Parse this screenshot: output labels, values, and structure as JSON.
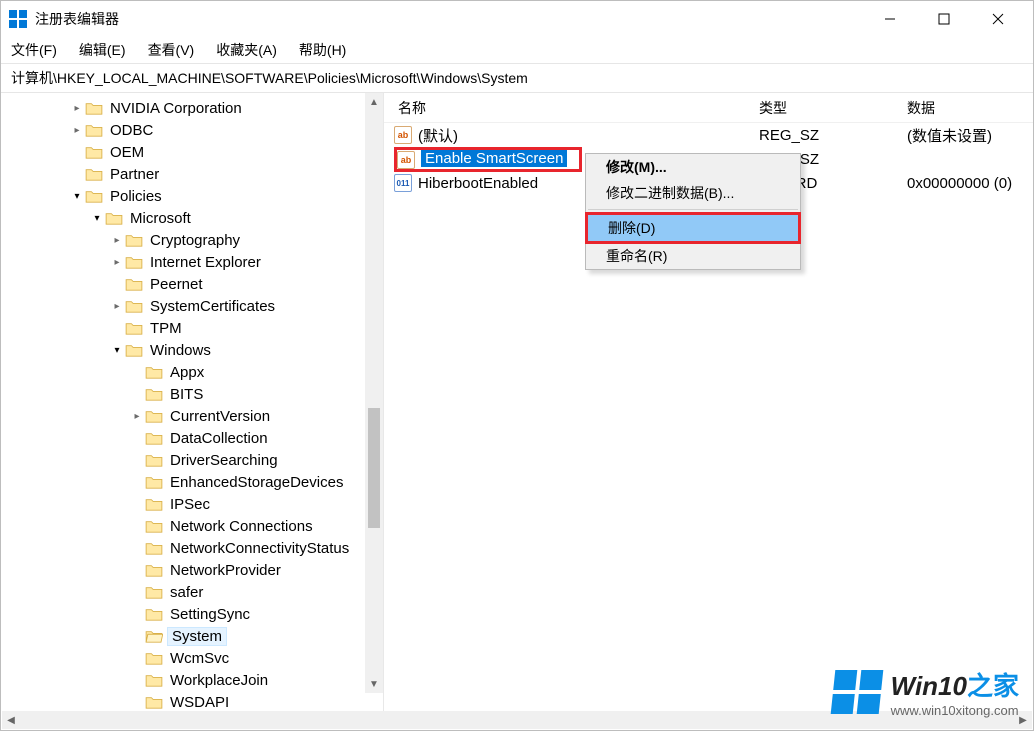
{
  "window": {
    "title": "注册表编辑器"
  },
  "menu": {
    "file": "文件(F)",
    "edit": "编辑(E)",
    "view": "查看(V)",
    "fav": "收藏夹(A)",
    "help": "帮助(H)"
  },
  "address": "计算机\\HKEY_LOCAL_MACHINE\\SOFTWARE\\Policies\\Microsoft\\Windows\\System",
  "columns": {
    "name": "名称",
    "type": "类型",
    "data": "数据"
  },
  "tree": {
    "items": [
      {
        "indent": 3,
        "exp": ">",
        "label": "NVIDIA Corporation"
      },
      {
        "indent": 3,
        "exp": ">",
        "label": "ODBC"
      },
      {
        "indent": 3,
        "exp": "",
        "label": "OEM"
      },
      {
        "indent": 3,
        "exp": "",
        "label": "Partner"
      },
      {
        "indent": 3,
        "exp": "v",
        "label": "Policies"
      },
      {
        "indent": 4,
        "exp": "v",
        "label": "Microsoft"
      },
      {
        "indent": 5,
        "exp": ">",
        "label": "Cryptography"
      },
      {
        "indent": 5,
        "exp": ">",
        "label": "Internet Explorer"
      },
      {
        "indent": 5,
        "exp": "",
        "label": "Peernet"
      },
      {
        "indent": 5,
        "exp": ">",
        "label": "SystemCertificates"
      },
      {
        "indent": 5,
        "exp": "",
        "label": "TPM"
      },
      {
        "indent": 5,
        "exp": "v",
        "label": "Windows"
      },
      {
        "indent": 6,
        "exp": "",
        "label": "Appx"
      },
      {
        "indent": 6,
        "exp": "",
        "label": "BITS"
      },
      {
        "indent": 6,
        "exp": ">",
        "label": "CurrentVersion"
      },
      {
        "indent": 6,
        "exp": "",
        "label": "DataCollection"
      },
      {
        "indent": 6,
        "exp": "",
        "label": "DriverSearching"
      },
      {
        "indent": 6,
        "exp": "",
        "label": "EnhancedStorageDevices"
      },
      {
        "indent": 6,
        "exp": "",
        "label": "IPSec"
      },
      {
        "indent": 6,
        "exp": "",
        "label": "Network Connections"
      },
      {
        "indent": 6,
        "exp": "",
        "label": "NetworkConnectivityStatus"
      },
      {
        "indent": 6,
        "exp": "",
        "label": "NetworkProvider"
      },
      {
        "indent": 6,
        "exp": "",
        "label": "safer"
      },
      {
        "indent": 6,
        "exp": "",
        "label": "SettingSync"
      },
      {
        "indent": 6,
        "exp": "",
        "label": "System",
        "selected": true
      },
      {
        "indent": 6,
        "exp": "",
        "label": "WcmSvc"
      },
      {
        "indent": 6,
        "exp": "",
        "label": "WorkplaceJoin"
      },
      {
        "indent": 6,
        "exp": "",
        "label": "WSDAPI"
      }
    ]
  },
  "values": [
    {
      "icon": "ab",
      "name": "(默认)",
      "type": "REG_SZ",
      "data": "(数值未设置)"
    },
    {
      "icon": "ab",
      "name": "Enable SmartScreen",
      "type": "REG_SZ",
      "data": "",
      "selected": true,
      "red": true
    },
    {
      "icon": "bin",
      "name": "HiberbootEnabled",
      "type": "REG_DWORD",
      "data": "0x00000000 (0)",
      "typeCover": "DWORD"
    }
  ],
  "context": {
    "modify": "修改(M)...",
    "modifyBin": "修改二进制数据(B)...",
    "delete": "删除(D)",
    "rename": "重命名(R)"
  },
  "watermark": {
    "brand": "Win10",
    "zhi": "之家",
    "url": "www.win10xitong.com"
  }
}
